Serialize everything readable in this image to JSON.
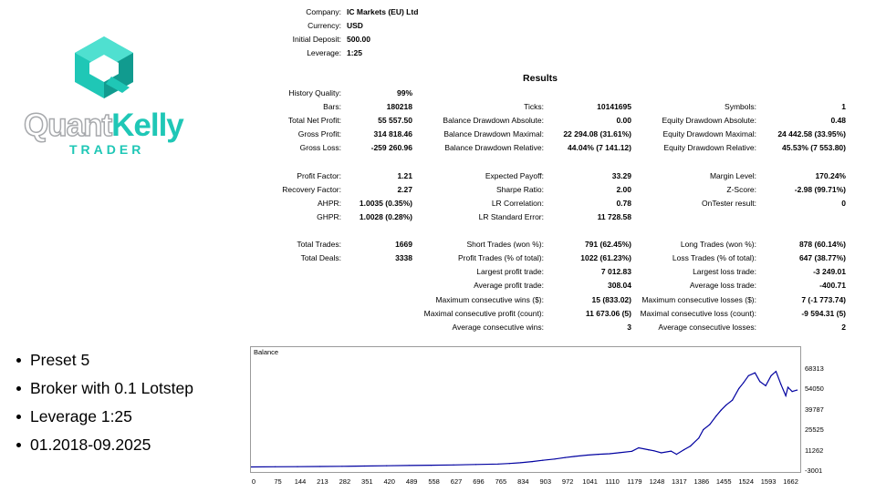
{
  "logo": {
    "word_quant": "Quant",
    "word_kelly": "Kelly",
    "word_trader": "TRADER",
    "teal": "#1fc7b6",
    "teal_dark": "#119b8f",
    "grey": "#a7a9ac"
  },
  "header": [
    {
      "label": "Company:",
      "value": "IC Markets (EU) Ltd"
    },
    {
      "label": "Currency:",
      "value": "USD"
    },
    {
      "label": "Initial Deposit:",
      "value": "500.00"
    },
    {
      "label": "Leverage:",
      "value": "1:25"
    }
  ],
  "results_title": "Results",
  "col1": [
    {
      "label": "History Quality:",
      "value": "99%"
    },
    {
      "label": "Bars:",
      "value": "180218"
    },
    {
      "label": "Total Net Profit:",
      "value": "55 557.50"
    },
    {
      "label": "Gross Profit:",
      "value": "314 818.46"
    },
    {
      "label": "Gross Loss:",
      "value": "-259 260.96"
    },
    {
      "label": "",
      "value": ""
    },
    {
      "label": "Profit Factor:",
      "value": "1.21"
    },
    {
      "label": "Recovery Factor:",
      "value": "2.27"
    },
    {
      "label": "AHPR:",
      "value": "1.0035 (0.35%)"
    },
    {
      "label": "GHPR:",
      "value": "1.0028 (0.28%)"
    },
    {
      "label": "",
      "value": ""
    },
    {
      "label": "Total Trades:",
      "value": "1669"
    },
    {
      "label": "Total Deals:",
      "value": "3338"
    }
  ],
  "col2": [
    {
      "label": "",
      "value": ""
    },
    {
      "label": "Ticks:",
      "value": "10141695"
    },
    {
      "label": "Balance Drawdown Absolute:",
      "value": "0.00"
    },
    {
      "label": "Balance Drawdown Maximal:",
      "value": "22 294.08 (31.61%)"
    },
    {
      "label": "Balance Drawdown Relative:",
      "value": "44.04% (7 141.12)"
    },
    {
      "label": "",
      "value": ""
    },
    {
      "label": "Expected Payoff:",
      "value": "33.29"
    },
    {
      "label": "Sharpe Ratio:",
      "value": "2.00"
    },
    {
      "label": "LR Correlation:",
      "value": "0.78"
    },
    {
      "label": "LR Standard Error:",
      "value": "11 728.58"
    },
    {
      "label": "",
      "value": ""
    },
    {
      "label": "Short Trades (won %):",
      "value": "791 (62.45%)"
    },
    {
      "label": "Profit Trades (% of total):",
      "value": "1022 (61.23%)"
    },
    {
      "label": "Largest profit trade:",
      "value": "7 012.83"
    },
    {
      "label": "Average profit trade:",
      "value": "308.04"
    },
    {
      "label": "Maximum consecutive wins ($):",
      "value": "15 (833.02)"
    },
    {
      "label": "Maximal consecutive profit (count):",
      "value": "11 673.06 (5)"
    },
    {
      "label": "Average consecutive wins:",
      "value": "3"
    }
  ],
  "col3": [
    {
      "label": "",
      "value": ""
    },
    {
      "label": "Symbols:",
      "value": "1"
    },
    {
      "label": "Equity Drawdown Absolute:",
      "value": "0.48"
    },
    {
      "label": "Equity Drawdown Maximal:",
      "value": "24 442.58 (33.95%)"
    },
    {
      "label": "Equity Drawdown Relative:",
      "value": "45.53% (7 553.80)"
    },
    {
      "label": "",
      "value": ""
    },
    {
      "label": "Margin Level:",
      "value": "170.24%"
    },
    {
      "label": "Z-Score:",
      "value": "-2.98 (99.71%)"
    },
    {
      "label": "OnTester result:",
      "value": "0"
    },
    {
      "label": "",
      "value": ""
    },
    {
      "label": "",
      "value": ""
    },
    {
      "label": "Long Trades (won %):",
      "value": "878 (60.14%)"
    },
    {
      "label": "Loss Trades (% of total):",
      "value": "647 (38.77%)"
    },
    {
      "label": "Largest loss trade:",
      "value": "-3 249.01"
    },
    {
      "label": "Average loss trade:",
      "value": "-400.71"
    },
    {
      "label": "Maximum consecutive losses ($):",
      "value": "7 (-1 773.74)"
    },
    {
      "label": "Maximal consecutive loss (count):",
      "value": "-9 594.31 (5)"
    },
    {
      "label": "Average consecutive losses:",
      "value": "2"
    }
  ],
  "bullets": [
    "Preset 5",
    "Broker with 0.1 Lotstep",
    "Leverage 1:25",
    "01.2018-09.2025"
  ],
  "chart_data": {
    "type": "line",
    "title": "Balance",
    "color": "#0000a0",
    "x_ticks": [
      "0",
      "75",
      "144",
      "213",
      "282",
      "351",
      "420",
      "489",
      "558",
      "627",
      "696",
      "765",
      "834",
      "903",
      "972",
      "1041",
      "1110",
      "1179",
      "1248",
      "1317",
      "1386",
      "1455",
      "1524",
      "1593",
      "1662"
    ],
    "y_ticks": [
      "68313",
      "54050",
      "39787",
      "25525",
      "11262",
      "-3001"
    ],
    "xlim": [
      0,
      1700
    ],
    "ylim": [
      -3001,
      75000
    ],
    "series": [
      {
        "x": [
          0,
          75,
          144,
          213,
          282,
          351,
          420,
          489,
          558,
          627,
          696,
          765,
          800,
          834,
          870,
          903,
          940,
          972,
          1000,
          1041,
          1075,
          1110,
          1140,
          1179,
          1200,
          1230,
          1248,
          1270,
          1300,
          1317,
          1340,
          1360,
          1386,
          1400,
          1420,
          1440,
          1455,
          1470,
          1490,
          1510,
          1524,
          1540,
          1560,
          1575,
          1593,
          1610,
          1625,
          1640,
          1655,
          1662,
          1675,
          1690
        ],
        "y": [
          500,
          600,
          700,
          800,
          900,
          1100,
          1300,
          1500,
          1700,
          1900,
          2200,
          2500,
          2900,
          3400,
          4200,
          5100,
          6000,
          7000,
          7800,
          8700,
          9300,
          9700,
          10400,
          11400,
          13800,
          12500,
          11700,
          10300,
          11500,
          9300,
          12500,
          15000,
          20600,
          26500,
          30000,
          36000,
          40000,
          43500,
          47000,
          55000,
          59000,
          64000,
          66000,
          60000,
          57000,
          64000,
          67000,
          58000,
          50000,
          56000,
          53000,
          54000
        ]
      }
    ]
  }
}
